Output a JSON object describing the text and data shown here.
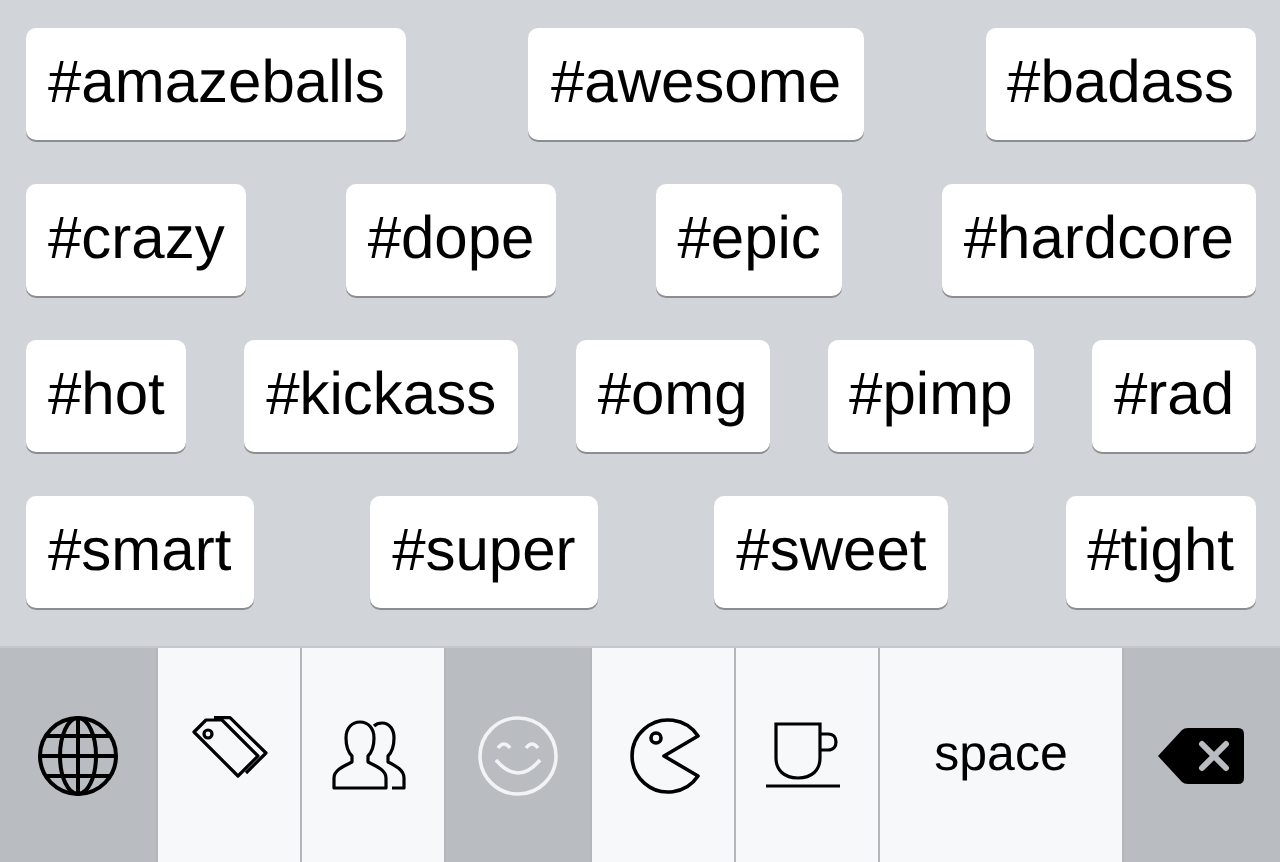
{
  "tag_rows": [
    [
      "#amazeballs",
      "#awesome",
      "#badass"
    ],
    [
      "#crazy",
      "#dope",
      "#epic",
      "#hardcore"
    ],
    [
      "#hot",
      "#kickass",
      "#omg",
      "#pimp",
      "#rad"
    ],
    [
      "#smart",
      "#super",
      "#sweet",
      "#tight"
    ]
  ],
  "keyboard_bar": {
    "categories": [
      {
        "kind": "tags",
        "selected": false
      },
      {
        "kind": "people",
        "selected": false
      },
      {
        "kind": "smiley",
        "selected": true
      },
      {
        "kind": "pacman",
        "selected": false
      },
      {
        "kind": "cup",
        "selected": false
      }
    ],
    "space_key": "space"
  }
}
